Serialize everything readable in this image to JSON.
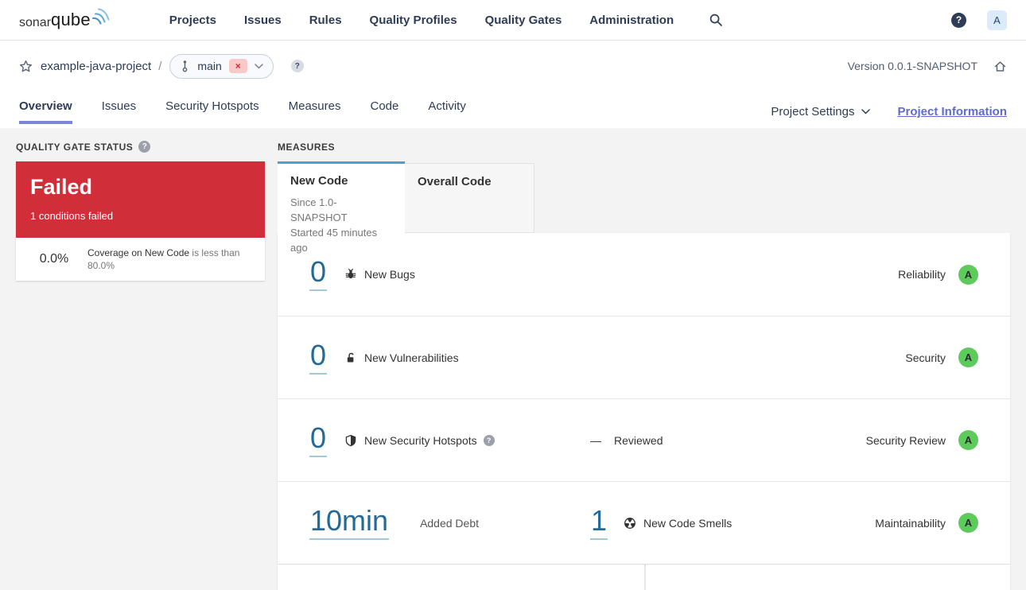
{
  "topnav": {
    "logo_bold": "sonar",
    "logo_light": "qube",
    "items": [
      "Projects",
      "Issues",
      "Rules",
      "Quality Profiles",
      "Quality Gates",
      "Administration"
    ],
    "avatar_letter": "A"
  },
  "breadcrumb": {
    "project": "example-java-project",
    "separator": "/",
    "branch": "main",
    "version_label": "Version 0.0.1-SNAPSHOT"
  },
  "tabbar": {
    "tabs": [
      "Overview",
      "Issues",
      "Security Hotspots",
      "Measures",
      "Code",
      "Activity"
    ],
    "active_tab": "Overview",
    "project_settings": "Project Settings",
    "project_information": "Project Information"
  },
  "quality_gate": {
    "section_title": "QUALITY GATE STATUS",
    "status": "Failed",
    "conditions_summary": "1 conditions failed",
    "condition": {
      "value": "0.0%",
      "metric": "Coverage on New Code",
      "rule": "is less than 80.0%"
    }
  },
  "measures": {
    "section_title": "MEASURES",
    "code_tabs": [
      {
        "label": "New Code",
        "since": "Since 1.0-SNAPSHOT",
        "started": "Started 45 minutes ago",
        "active": true
      },
      {
        "label": "Overall Code",
        "active": false
      }
    ],
    "rows": [
      {
        "value": "0",
        "label": "New Bugs",
        "domain": "Reliability",
        "rating": "A"
      },
      {
        "value": "0",
        "label": "New Vulnerabilities",
        "domain": "Security",
        "rating": "A"
      },
      {
        "value": "0",
        "label": "New Security Hotspots",
        "dash": "—",
        "reviewed_label": "Reviewed",
        "domain": "Security Review",
        "rating": "A"
      },
      {
        "debt_value": "10min",
        "debt_label": "Added Debt",
        "smells_value": "1",
        "smells_label": "New Code Smells",
        "domain": "Maintainability",
        "rating": "A"
      }
    ]
  },
  "icons": {
    "search": "magnifier",
    "help": "question-mark-circle",
    "branch": "git-branch",
    "close": "x-mark",
    "star": "star-outline",
    "home": "house",
    "bug": "bug",
    "vulnerability": "open-lock",
    "security_hotspot": "shield",
    "code_smell": "segmented-wheel",
    "chevron": "chevron-down"
  },
  "colors": {
    "failed_red": "#d02f3a",
    "rating_a_green": "#5ccb5c",
    "new_code_tab_blue": "#4b9fd5",
    "measure_link_blue": "#236a97",
    "accent_purple": "#7b87d6",
    "brand_wave_blue": "#549dd0"
  }
}
